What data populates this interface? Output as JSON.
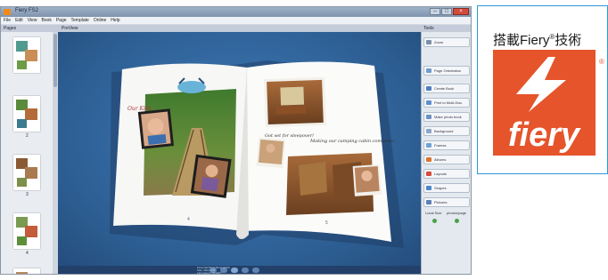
{
  "window": {
    "title": "Fiery FS2",
    "menu": [
      "File",
      "Edit",
      "View",
      "Book",
      "Page",
      "Template",
      "Online",
      "Help"
    ],
    "controls": {
      "minimize": "–",
      "maximize": "□",
      "close": "×"
    }
  },
  "pages_panel": {
    "title": "Pages",
    "thumbs": [
      {
        "label": ""
      },
      {
        "label": "2"
      },
      {
        "label": "3"
      },
      {
        "label": "4"
      },
      {
        "label": ""
      }
    ]
  },
  "preview": {
    "title": "PreView",
    "left_page_number": "4",
    "right_page_number": "5",
    "nav_info": [
      "Personal Photo Book (6/19)",
      "Size: 28cm PM",
      "Last saved: 10/19/07"
    ]
  },
  "tools_panel": {
    "title": "Tools",
    "items": [
      {
        "label": "Zoom",
        "color": "#7a8fa8"
      },
      {
        "label": "Page Orientation",
        "color": "#6d9ccf"
      },
      {
        "label": "Create Book",
        "color": "#4e7fc0"
      },
      {
        "label": "Print to Multi-Disc",
        "color": "#5c8fd0"
      },
      {
        "label": "Make photo book",
        "color": "#6b93c2"
      },
      {
        "label": "Background",
        "color": "#8aa6c9"
      },
      {
        "label": "Frames",
        "color": "#6ea2d8"
      },
      {
        "label": "Albums",
        "color": "#d8742c"
      },
      {
        "label": "Layouts",
        "color": "#d84a3a"
      },
      {
        "label": "Shapes",
        "color": "#4c86c7"
      },
      {
        "label": "Pictures",
        "color": "#5c7fb8"
      }
    ],
    "sliders": {
      "left_label": "Local Size",
      "right_label": "photos/page"
    }
  },
  "fiery": {
    "caption": "搭載Fiery",
    "caption_reg": "®",
    "caption_suffix": "技術",
    "logo_text": "fiery",
    "logo_reg": "®",
    "brand_color": "#e5542b"
  }
}
